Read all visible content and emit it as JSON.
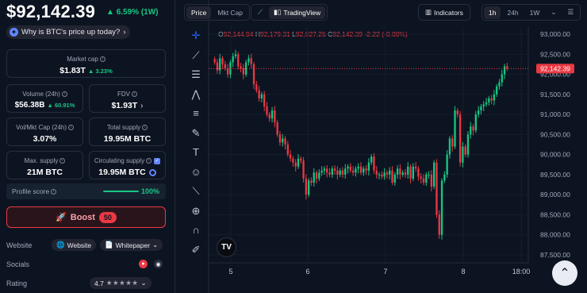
{
  "header": {
    "price": "$92,142.39",
    "change": "6.59% (1W)",
    "why_label": "Why is BTC's price up today?"
  },
  "stats": {
    "market_cap": {
      "label": "Market cap",
      "value": "$1.83T",
      "change": "3.23%"
    },
    "volume": {
      "label": "Volume (24h)",
      "value": "$56.38B",
      "change": "60.91%"
    },
    "fdv": {
      "label": "FDV",
      "value": "$1.93T"
    },
    "vol_mkt_cap": {
      "label": "Vol/Mkt Cap (24h)",
      "value": "3.07%"
    },
    "total_supply": {
      "label": "Total supply",
      "value": "19.95M BTC"
    },
    "max_supply": {
      "label": "Max. supply",
      "value": "21M BTC"
    },
    "circulating_supply": {
      "label": "Circulating supply",
      "value": "19.95M BTC"
    }
  },
  "profile_score": {
    "label": "Profile score",
    "value": "100%",
    "fill_fraction": 1.0
  },
  "boost": {
    "label": "Boost",
    "count": "50"
  },
  "links": {
    "website_label": "Website",
    "website_pill": "Website",
    "whitepaper_pill": "Whitepaper",
    "socials_label": "Socials",
    "rating_label": "Rating",
    "rating_value": "4.7",
    "stars": "★★★★★"
  },
  "chart_tabs": {
    "price": "Price",
    "mkt_cap": "Mkt Cap",
    "tradingview": "TradingView",
    "indicators": "Indicators"
  },
  "timeframes": {
    "h1": "1h",
    "h24": "24h",
    "w1": "1W"
  },
  "ohlc": {
    "o": "92,144.94",
    "h": "92,179.31",
    "l": "92,027.26",
    "c": "92,142.39",
    "chg": "-2.22 (-0.00%)"
  },
  "colors": {
    "up": "#16c784",
    "down": "#ea3943",
    "accent": "#6188ff"
  },
  "chart_data": {
    "type": "candlestick",
    "x_ticks": [
      "5",
      "6",
      "7",
      "8",
      "18:00"
    ],
    "y_ticks": [
      93000,
      92500,
      92000,
      91500,
      91000,
      90500,
      90000,
      89500,
      89000,
      88500,
      88000,
      87500
    ],
    "ylim": [
      87300,
      93200
    ],
    "last_price_label": "92,142.39",
    "last_price": 92142.39,
    "closes": [
      92300,
      92100,
      92400,
      92250,
      92150,
      92000,
      92300,
      92450,
      92500,
      92200,
      92150,
      92000,
      92300,
      92400,
      92250,
      91750,
      91600,
      91400,
      91500,
      91200,
      91000,
      90900,
      91100,
      90800,
      90500,
      90300,
      90400,
      90250,
      90000,
      89900,
      89800,
      89700,
      89900,
      89850,
      89400,
      89000,
      89350,
      89300,
      89550,
      89400,
      89550,
      89600,
      89650,
      89550,
      89500,
      89650,
      89600,
      89500,
      89600,
      89500,
      89650,
      89700,
      89600,
      89550,
      89650,
      89700,
      89550,
      89650,
      89600,
      89800,
      89950,
      89600,
      89500,
      89500,
      89450,
      89550,
      89500,
      89600,
      89300,
      89500,
      89650,
      89500,
      89550,
      89500,
      89700,
      89400,
      89700,
      89650,
      89450,
      89400,
      89300,
      89500,
      89500,
      89200,
      89800,
      88500,
      88000,
      89350,
      89500,
      90000,
      90400,
      90200,
      91100,
      91000,
      89800,
      90200,
      90000,
      90500,
      90700,
      90600,
      91000,
      91100,
      91200,
      91250,
      91300,
      91400,
      91350,
      91500,
      91700,
      91800,
      92000,
      92200,
      92142
    ]
  }
}
